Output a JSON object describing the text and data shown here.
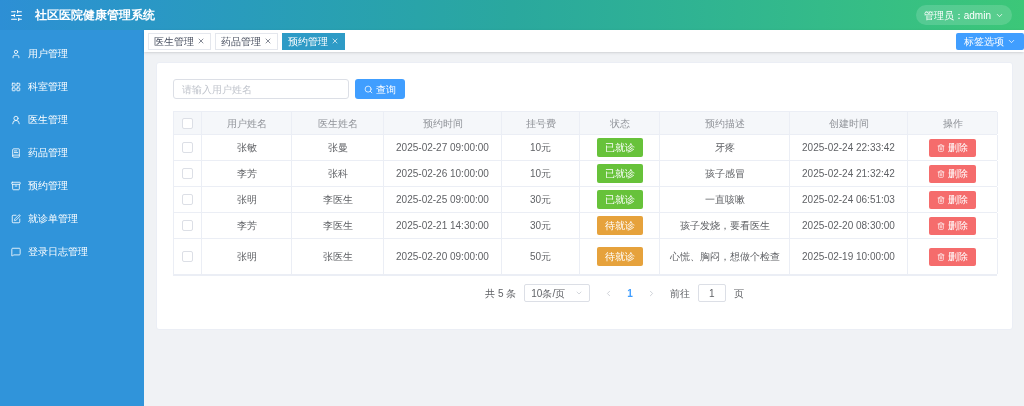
{
  "header": {
    "title": "社区医院健康管理系统",
    "user_menu": "管理员：admin"
  },
  "sidebar": {
    "items": [
      {
        "label": "用户管理"
      },
      {
        "label": "科室管理"
      },
      {
        "label": "医生管理"
      },
      {
        "label": "药品管理"
      },
      {
        "label": "预约管理"
      },
      {
        "label": "就诊单管理"
      },
      {
        "label": "登录日志管理"
      }
    ]
  },
  "tabs": [
    {
      "label": "医生管理",
      "selected": false
    },
    {
      "label": "药品管理",
      "selected": false
    },
    {
      "label": "预约管理",
      "selected": true
    }
  ],
  "tab_options_button": "标签选项",
  "search": {
    "placeholder": "请输入用户姓名",
    "button": "查询"
  },
  "table": {
    "header_checked": false,
    "columns": [
      "用户姓名",
      "医生姓名",
      "预约时间",
      "挂号费",
      "状态",
      "预约描述",
      "创建时间",
      "操作"
    ],
    "rows": [
      {
        "checked": false,
        "user": "张敏",
        "doctor": "张曼",
        "time": "2025-02-27 09:00:00",
        "fee": "10元",
        "status": "已就诊",
        "color": "#67c23a",
        "description": "牙疼",
        "created": "2025-02-24 22:33:42",
        "action": "删除"
      },
      {
        "checked": false,
        "user": "李芳",
        "doctor": "张科",
        "time": "2025-02-26 10:00:00",
        "fee": "10元",
        "status": "已就诊",
        "color": "#67c23a",
        "description": "孩子感冒",
        "created": "2025-02-24 21:32:42",
        "action": "删除"
      },
      {
        "checked": false,
        "user": "张明",
        "doctor": "李医生",
        "time": "2025-02-25 09:00:00",
        "fee": "30元",
        "status": "已就诊",
        "color": "#67c23a",
        "description": "一直咳嗽",
        "created": "2025-02-24 06:51:03",
        "action": "删除"
      },
      {
        "checked": false,
        "user": "李芳",
        "doctor": "李医生",
        "time": "2025-02-21 14:30:00",
        "fee": "30元",
        "status": "待就诊",
        "color": "#e6a23c",
        "description": "孩子发烧，要看医生",
        "created": "2025-02-20 08:30:00",
        "action": "删除"
      },
      {
        "checked": false,
        "user": "张明",
        "doctor": "张医生",
        "time": "2025-02-20 09:00:00",
        "fee": "50元",
        "status": "待就诊",
        "color": "#e6a23c",
        "description": "心慌、胸闷，想做个检查",
        "created": "2025-02-19 10:00:00",
        "action": "删除"
      }
    ]
  },
  "pagination": {
    "total": "共 5 条",
    "page_size": "10条/页",
    "pages": [
      {
        "label": "1",
        "selected": true
      }
    ],
    "goto_label": "前往",
    "goto_value": "1",
    "goto_unit": "页"
  }
}
